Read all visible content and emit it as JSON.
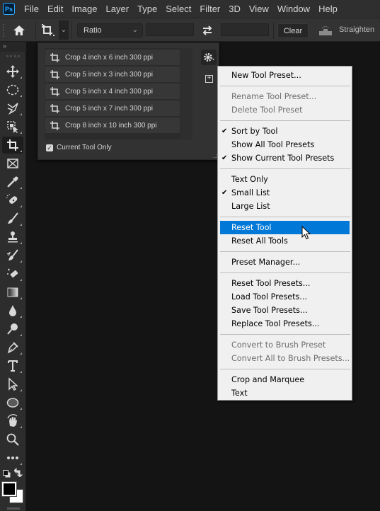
{
  "app": {
    "logo_text": "Ps"
  },
  "menubar": {
    "items": [
      "File",
      "Edit",
      "Image",
      "Layer",
      "Type",
      "Select",
      "Filter",
      "3D",
      "View",
      "Window",
      "Help"
    ]
  },
  "options_bar": {
    "ratio_select": {
      "value": "Ratio"
    },
    "width_field": {
      "value": ""
    },
    "height_field": {
      "value": ""
    },
    "clear_label": "Clear",
    "straighten_label": "Straighten"
  },
  "toolbar": {
    "collapse_label": "»",
    "tools": [
      {
        "name": "move-tool",
        "icon": "move-icon"
      },
      {
        "name": "elliptical-marquee-tool",
        "icon": "ellipse-marquee-icon"
      },
      {
        "name": "lasso-tool",
        "icon": "polygonal-lasso-icon"
      },
      {
        "name": "object-selection-tool",
        "icon": "object-selection-icon"
      },
      {
        "name": "crop-tool",
        "icon": "crop-icon",
        "active": true
      },
      {
        "name": "frame-tool",
        "icon": "frame-icon"
      },
      {
        "name": "eyedropper-tool",
        "icon": "eyedropper-icon"
      },
      {
        "name": "healing-brush-tool",
        "icon": "bandage-icon"
      },
      {
        "name": "brush-tool",
        "icon": "brush-icon"
      },
      {
        "name": "clone-stamp-tool",
        "icon": "stamp-icon"
      },
      {
        "name": "history-brush-tool",
        "icon": "history-brush-icon"
      },
      {
        "name": "eraser-tool",
        "icon": "eraser-icon"
      },
      {
        "name": "gradient-tool",
        "icon": "gradient-icon"
      },
      {
        "name": "blur-tool",
        "icon": "drop-icon"
      },
      {
        "name": "dodge-tool",
        "icon": "dodge-icon"
      },
      {
        "name": "pen-tool",
        "icon": "pen-icon"
      },
      {
        "name": "type-tool",
        "icon": "type-icon"
      },
      {
        "name": "path-selection-tool",
        "icon": "arrow-icon"
      },
      {
        "name": "ellipse-tool",
        "icon": "ellipse-icon"
      },
      {
        "name": "rotate-view-tool",
        "icon": "hand-rotate-icon"
      },
      {
        "name": "zoom-tool",
        "icon": "magnifier-icon"
      },
      {
        "name": "edit-toolbar",
        "icon": "more-icon"
      }
    ],
    "foreground_color": "#000000",
    "background_color": "#ffffff"
  },
  "preset_panel": {
    "presets": [
      "Crop 4 inch x 6 inch 300 ppi",
      "Crop 5 inch x 3 inch 300 ppi",
      "Crop 5 inch x 4 inch 300 ppi",
      "Crop 5 inch x 7 inch 300 ppi",
      "Crop 8 inch x 10 inch 300 ppi"
    ],
    "current_tool_only_label": "Current Tool Only",
    "current_tool_only_checked": true,
    "new_preset_symbol": "+"
  },
  "context_menu": {
    "groups": [
      [
        {
          "label": "New Tool Preset...",
          "enabled": true
        }
      ],
      [
        {
          "label": "Rename Tool Preset...",
          "enabled": false
        },
        {
          "label": "Delete Tool Preset",
          "enabled": false
        }
      ],
      [
        {
          "label": "Sort by Tool",
          "enabled": true,
          "checked": true
        },
        {
          "label": "Show All Tool Presets",
          "enabled": true
        },
        {
          "label": "Show Current Tool Presets",
          "enabled": true,
          "checked": true
        }
      ],
      [
        {
          "label": "Text Only",
          "enabled": true
        },
        {
          "label": "Small List",
          "enabled": true,
          "checked": true
        },
        {
          "label": "Large List",
          "enabled": true
        }
      ],
      [
        {
          "label": "Reset Tool",
          "enabled": true,
          "highlighted": true
        },
        {
          "label": "Reset All Tools",
          "enabled": true
        }
      ],
      [
        {
          "label": "Preset Manager...",
          "enabled": true
        }
      ],
      [
        {
          "label": "Reset Tool Presets...",
          "enabled": true
        },
        {
          "label": "Load Tool Presets...",
          "enabled": true
        },
        {
          "label": "Save Tool Presets...",
          "enabled": true
        },
        {
          "label": "Replace Tool Presets...",
          "enabled": true
        }
      ],
      [
        {
          "label": "Convert to Brush Preset",
          "enabled": false
        },
        {
          "label": "Convert All to Brush Presets...",
          "enabled": false
        }
      ],
      [
        {
          "label": "Crop and Marquee",
          "enabled": true
        },
        {
          "label": "Text",
          "enabled": true
        }
      ]
    ],
    "check_glyph": "✔",
    "highlight_color": "#0078d7"
  }
}
